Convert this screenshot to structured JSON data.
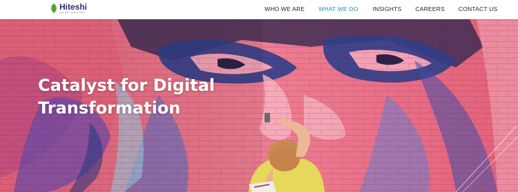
{
  "brand": {
    "name": "Hiteshi",
    "tagline": "think. plan. succeed. build it.",
    "logo_color": "#2b2e66",
    "leaf_color": "#5fb136"
  },
  "nav": {
    "items": [
      {
        "label": "WHO WE ARE",
        "active": false
      },
      {
        "label": "WHAT WE DO",
        "active": true
      },
      {
        "label": "INSIGHTS",
        "active": false
      },
      {
        "label": "CAREERS",
        "active": false
      },
      {
        "label": "CONTACT US",
        "active": false
      }
    ],
    "active_color": "#2a86c9"
  },
  "hero": {
    "title_line1": "Catalyst for Digital",
    "title_line2": "Transformation",
    "image": "street-art-mural-photo"
  }
}
